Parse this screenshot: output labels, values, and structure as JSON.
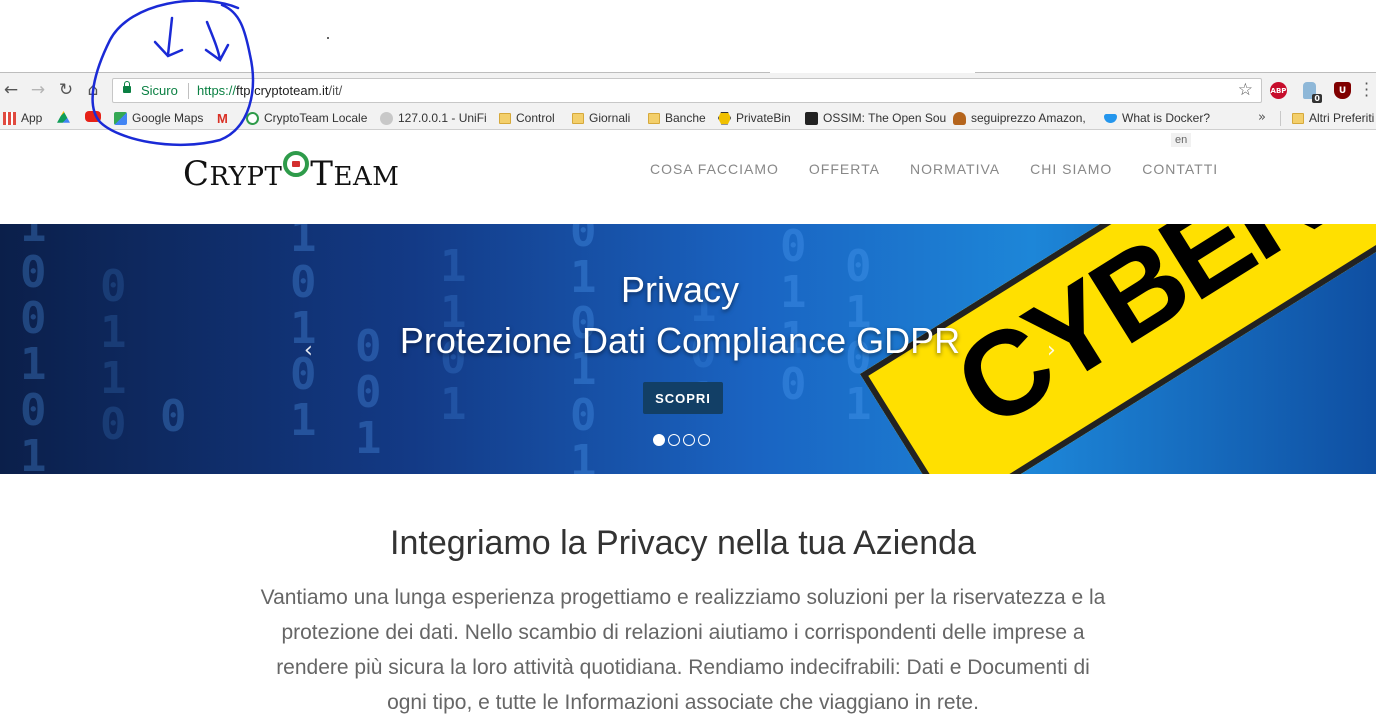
{
  "browser": {
    "omnibox": {
      "secure_label": "Sicuro",
      "url_scheme": "https://",
      "url_domain": "ftp.cryptoteam.it",
      "url_path": "/it/"
    },
    "extensions": {
      "abp_label": "ABP",
      "ghost_badge": "0",
      "ublock_label": "U"
    },
    "bookmarks": [
      {
        "label": "App",
        "icon": "apps-grid-icon"
      },
      {
        "label": "",
        "icon": "google-drive-icon"
      },
      {
        "label": "",
        "icon": "youtube-icon"
      },
      {
        "label": "Google Maps",
        "icon": "google-maps-icon"
      },
      {
        "label": "",
        "icon": "gmail-icon"
      },
      {
        "label": "CryptoTeam Locale",
        "icon": "cryptoteam-icon"
      },
      {
        "label": "127.0.0.1 - UniFi",
        "icon": "unifi-icon"
      },
      {
        "label": "Control",
        "icon": "folder-icon"
      },
      {
        "label": "Giornali",
        "icon": "folder-icon"
      },
      {
        "label": "Banche",
        "icon": "folder-icon"
      },
      {
        "label": "PrivateBin",
        "icon": "privatebin-icon"
      },
      {
        "label": "OSSIM: The Open Sou",
        "icon": "ossim-icon"
      },
      {
        "label": "seguiprezzo Amazon,",
        "icon": "seguiprezzo-icon"
      },
      {
        "label": "What is Docker?",
        "icon": "docker-icon"
      }
    ],
    "overflow_label": "»",
    "other_bookmarks": "Altri Preferiti"
  },
  "header": {
    "logo": {
      "part1_big": "C",
      "part1_small": "RYPT",
      "part2_big": "T",
      "part2_small": "EAM"
    },
    "lang": "en",
    "nav": [
      "COSA FACCIAMO",
      "OFFERTA",
      "NORMATIVA",
      "CHI SIAMO",
      "CONTATTI"
    ]
  },
  "hero": {
    "title_line1": "Privacy",
    "title_line2": "Protezione Dati Compliance GDPR",
    "cta": "SCOPRI",
    "tape_text": "CYBER CR",
    "prev": "‹",
    "next": "›",
    "slides_count": 4,
    "active_slide": 1
  },
  "content": {
    "headline": "Integriamo la Privacy nella tua Azienda",
    "lead": "Vantiamo una lunga esperienza progettiamo e realizziamo soluzioni per la riservatezza e la protezione dei dati. Nello scambio di relazioni aiutiamo i corrispondenti delle imprese a rendere più sicura la loro attività quotidiana. Rendiamo indecifrabili: Dati e Documenti di ogni tipo, e tutte le Informazioni associate che viaggiano in rete."
  },
  "colors": {
    "secure_green": "#0b8043",
    "nav_gray": "#888888",
    "cta_bg": "#123f66",
    "annotation_blue": "#1a2ad6",
    "tape_yellow": "#ffe000"
  }
}
